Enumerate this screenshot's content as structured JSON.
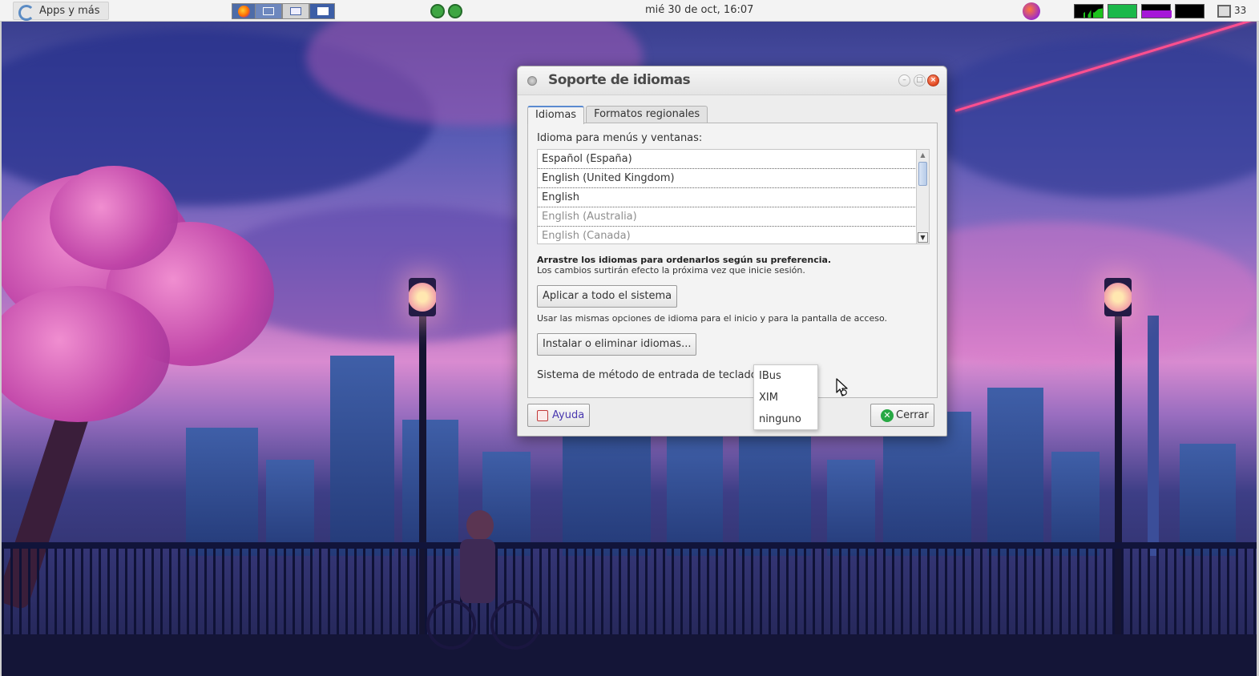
{
  "panel": {
    "apps_label": "Apps y más",
    "clock": "mié 30 de oct, 16:07",
    "notifications_count": "33",
    "tray_icons": [
      "firefox-icon",
      "window-icon",
      "window-icon",
      "window-icon",
      "green-app-icon",
      "green-app-icon",
      "system-app-icon"
    ],
    "monitors": [
      "cpu-monitor",
      "memory-monitor",
      "network-monitor",
      "load-monitor"
    ]
  },
  "dialog": {
    "title": "Soporte de idiomas",
    "tabs": [
      {
        "label": "Idiomas"
      },
      {
        "label": "Formatos regionales"
      }
    ],
    "languages_heading": "Idioma para menús y ventanas:",
    "languages": [
      {
        "label": "Español (España)"
      },
      {
        "label": "English (United Kingdom)"
      },
      {
        "label": "English"
      },
      {
        "label": "English (Australia)"
      },
      {
        "label": "English (Canada)"
      }
    ],
    "hint_bold": "Arrastre los idiomas para ordenarlos según su preferencia.",
    "hint_normal": "Los cambios surtirán efecto la próxima vez que inicie sesión.",
    "apply_button": "Aplicar a todo el sistema",
    "apply_note": "Usar las mismas opciones de idioma para el inicio y para la pantalla de acceso.",
    "install_button": "Instalar o eliminar idiomas...",
    "input_method_label": "Sistema de método de entrada de teclado:",
    "input_method_options": [
      "IBus",
      "XIM",
      "ninguno"
    ],
    "help_button": "Ayuda",
    "close_button": "Cerrar"
  },
  "colors": {
    "tab_accent": "#5a8ad0",
    "close_button_icon": "#27a844",
    "help_text": "#4a39b0",
    "window_close": "#e0441c"
  }
}
